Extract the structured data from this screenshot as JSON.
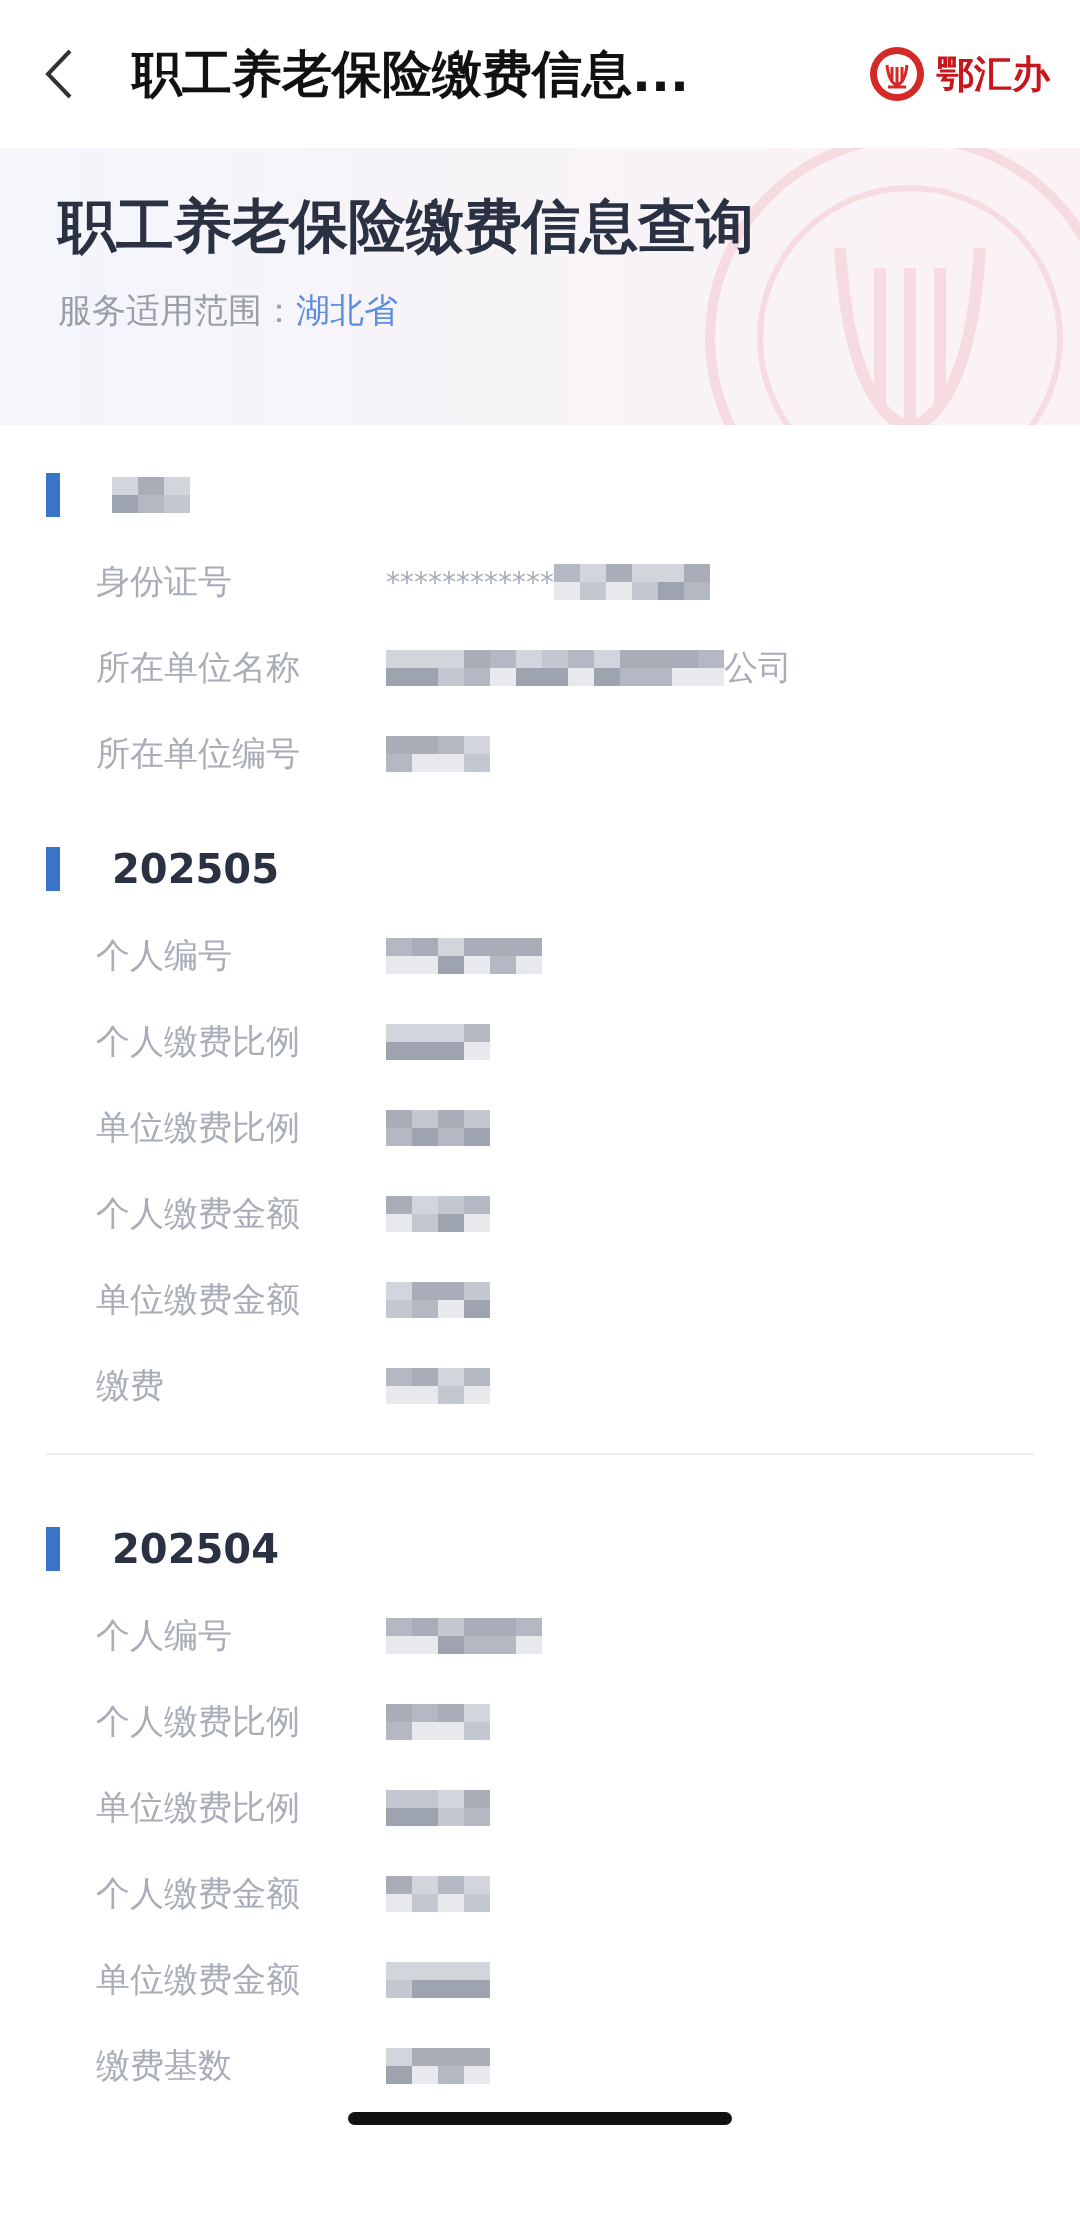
{
  "nav": {
    "title": "职工养老保险缴费信息...",
    "logo_text": "鄂汇办"
  },
  "banner": {
    "title": "职工养老保险缴费信息查询",
    "scope_label": "服务适用范围：",
    "scope_value": "湖北省"
  },
  "sections": [
    {
      "kind": "redacted",
      "rows": [
        {
          "label": "身份证号",
          "kind": "masked_prefix",
          "value": "************"
        },
        {
          "label": "所在单位名称",
          "kind": "masked_suffix",
          "value": "公司"
        },
        {
          "label": "所在单位编号",
          "kind": "masked"
        }
      ]
    },
    {
      "kind": "month",
      "heading": "202505",
      "rows": [
        {
          "label": "个人编号",
          "kind": "masked"
        },
        {
          "label": "个人缴费比例",
          "kind": "masked"
        },
        {
          "label": "单位缴费比例",
          "kind": "masked"
        },
        {
          "label": "个人缴费金额",
          "kind": "masked"
        },
        {
          "label": "单位缴费金额",
          "kind": "masked"
        },
        {
          "label": "缴费",
          "kind": "masked"
        }
      ]
    },
    {
      "kind": "month",
      "heading": "202504",
      "rows": [
        {
          "label": "个人编号",
          "kind": "masked"
        },
        {
          "label": "个人缴费比例",
          "kind": "masked"
        },
        {
          "label": "单位缴费比例",
          "kind": "masked"
        },
        {
          "label": "个人缴费金额",
          "kind": "masked"
        },
        {
          "label": "单位缴费金额",
          "kind": "masked"
        },
        {
          "label": "缴费基数",
          "kind": "masked"
        }
      ]
    }
  ]
}
